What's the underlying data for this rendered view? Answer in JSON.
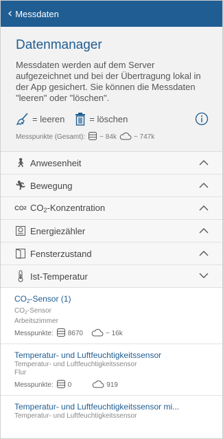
{
  "nav": {
    "back_label": "Messdaten"
  },
  "intro": {
    "title": "Datenmanager",
    "description": "Messdaten werden auf dem Server aufgezeichnet und bei der Übertragung lokal in der App gesichert. Sie können die Messdaten \"leeren\" oder \"löschen\".",
    "legend_clear": "= leeren",
    "legend_delete": "= löschen",
    "stats_label": "Messpunkte (Gesamt):",
    "stats_local": "~ 84k",
    "stats_cloud": "~ 747k"
  },
  "categories": [
    {
      "icon": "walking-person-icon",
      "label": "Anwesenheit",
      "state": "collapsed"
    },
    {
      "icon": "running-person-icon",
      "label": "Bewegung",
      "state": "collapsed"
    },
    {
      "icon": "co2-icon",
      "label_prefix": "CO",
      "label_sub": "2",
      "label_suffix": "-Konzentration",
      "state": "collapsed"
    },
    {
      "icon": "energy-meter-icon",
      "label": "Energiezähler",
      "state": "collapsed"
    },
    {
      "icon": "window-icon",
      "label": "Fensterzustand",
      "state": "collapsed"
    },
    {
      "icon": "thermometer-icon",
      "label": "Ist-Temperatur",
      "state": "expanded"
    }
  ],
  "sensors": [
    {
      "name_prefix": "CO",
      "name_sub": "2",
      "name_suffix": "-Sensor (1)",
      "type_prefix": "CO",
      "type_sub": "2",
      "type_suffix": "-Sensor",
      "room": "Arbeitszimmer",
      "points_label": "Messpunkte:",
      "local": "8670",
      "cloud": "~ 16k"
    },
    {
      "name": "Temperatur- und Luftfeuchtigkeitssensor",
      "type": "Temperatur- und Luftfeuchtigkeitssensor",
      "room": "Flur",
      "points_label": "Messpunkte:",
      "local": "0",
      "cloud": "919"
    },
    {
      "name": "Temperatur- und Luftfeuchtigkeitssensor mi...",
      "type": "Temperatur- und Luftfeuchtigkeitssensor"
    }
  ],
  "colors": {
    "brand": "#1f5d92",
    "accent_link": "#1f5d92"
  }
}
